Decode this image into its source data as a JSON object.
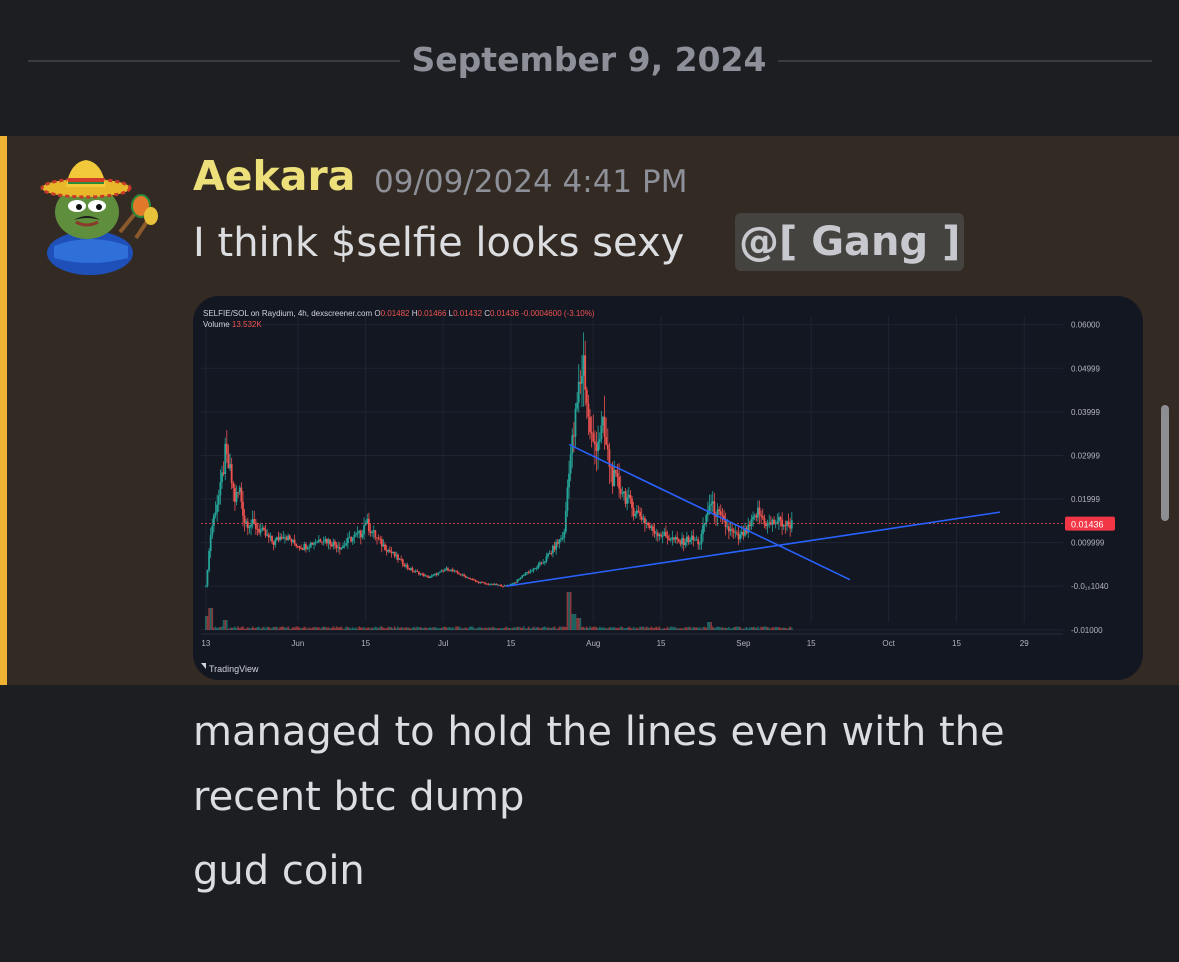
{
  "date_divider": "September 9, 2024",
  "message": {
    "author": "Aekara",
    "timestamp": "09/09/2024 4:41 PM",
    "text1": "I think $selfie looks sexy",
    "mention": "@[ Gang ]",
    "text2": "managed to hold the lines even with the recent btc dump",
    "text3": "gud coin"
  },
  "colors": {
    "background": "#1d1e22",
    "highlight": "#332b23",
    "highlight_bar": "#f0b232",
    "author": "#ede07a",
    "up_candle": "#26a69a",
    "down_candle": "#ef5350",
    "trendline": "#2962ff"
  },
  "chart_data": {
    "type": "candlestick",
    "header": {
      "symbol": "SELFIE/SOL on Raydium, 4h, dexscreener.com",
      "o_label": "O",
      "o_value": "0.01482",
      "h_label": "H",
      "h_value": "0.01466",
      "l_label": "L",
      "l_value": "0.01432",
      "c_label": "C",
      "c_value": "0.01436",
      "change": "-0.0004600 (-3.10%)",
      "volume_label": "Volume",
      "volume_value": "13.532K"
    },
    "y_ticks": [
      {
        "label": "0.06000",
        "v": 0.06
      },
      {
        "label": "0.04999",
        "v": 0.05
      },
      {
        "label": "0.03999",
        "v": 0.04
      },
      {
        "label": "0.02999",
        "v": 0.03
      },
      {
        "label": "0.01999",
        "v": 0.02
      },
      {
        "label": "0.009999",
        "v": 0.01
      },
      {
        "label": "-0.0₁₆1040",
        "v": 0.0
      },
      {
        "label": "-0.01000",
        "v": -0.01
      }
    ],
    "x_ticks": [
      {
        "label": "13",
        "d": 0
      },
      {
        "label": "Jun",
        "d": 19
      },
      {
        "label": "15",
        "d": 33
      },
      {
        "label": "Jul",
        "d": 49
      },
      {
        "label": "15",
        "d": 63
      },
      {
        "label": "Aug",
        "d": 80
      },
      {
        "label": "15",
        "d": 94
      },
      {
        "label": "Sep",
        "d": 111
      },
      {
        "label": "15",
        "d": 125
      },
      {
        "label": "Oct",
        "d": 141
      },
      {
        "label": "15",
        "d": 155
      },
      {
        "label": "29",
        "d": 169
      }
    ],
    "x_range": [
      -1,
      177
    ],
    "y_range": [
      -0.0105,
      0.062
    ],
    "current_price": {
      "label": "0.01436",
      "v": 0.01436
    },
    "price_path": [
      [
        0,
        0.0
      ],
      [
        1,
        0.012
      ],
      [
        2,
        0.018
      ],
      [
        3,
        0.022
      ],
      [
        4,
        0.03
      ],
      [
        5,
        0.026
      ],
      [
        6,
        0.02
      ],
      [
        7,
        0.022
      ],
      [
        8,
        0.015
      ],
      [
        10,
        0.014
      ],
      [
        12,
        0.012
      ],
      [
        14,
        0.01
      ],
      [
        16,
        0.012
      ],
      [
        18,
        0.01
      ],
      [
        20,
        0.009
      ],
      [
        22,
        0.01
      ],
      [
        24,
        0.011
      ],
      [
        26,
        0.01
      ],
      [
        28,
        0.009
      ],
      [
        30,
        0.011
      ],
      [
        32,
        0.012
      ],
      [
        33,
        0.015
      ],
      [
        34,
        0.013
      ],
      [
        36,
        0.01
      ],
      [
        38,
        0.008
      ],
      [
        40,
        0.006
      ],
      [
        42,
        0.004
      ],
      [
        44,
        0.003
      ],
      [
        46,
        0.002
      ],
      [
        48,
        0.003
      ],
      [
        50,
        0.004
      ],
      [
        52,
        0.003
      ],
      [
        54,
        0.002
      ],
      [
        56,
        0.001
      ],
      [
        58,
        0.0005
      ],
      [
        60,
        0.0003
      ],
      [
        62,
        0.0
      ],
      [
        64,
        0.001
      ],
      [
        66,
        0.003
      ],
      [
        68,
        0.004
      ],
      [
        70,
        0.006
      ],
      [
        72,
        0.009
      ],
      [
        74,
        0.012
      ],
      [
        75,
        0.028
      ],
      [
        76,
        0.035
      ],
      [
        77,
        0.045
      ],
      [
        78,
        0.052
      ],
      [
        79,
        0.038
      ],
      [
        80,
        0.032
      ],
      [
        82,
        0.036
      ],
      [
        83,
        0.03
      ],
      [
        84,
        0.025
      ],
      [
        86,
        0.022
      ],
      [
        88,
        0.018
      ],
      [
        90,
        0.016
      ],
      [
        92,
        0.013
      ],
      [
        94,
        0.012
      ],
      [
        96,
        0.011
      ],
      [
        98,
        0.01
      ],
      [
        100,
        0.011
      ],
      [
        102,
        0.01
      ],
      [
        104,
        0.019
      ],
      [
        106,
        0.016
      ],
      [
        108,
        0.013
      ],
      [
        110,
        0.011
      ],
      [
        112,
        0.013
      ],
      [
        114,
        0.017
      ],
      [
        116,
        0.014
      ],
      [
        118,
        0.015
      ],
      [
        120,
        0.014
      ],
      [
        121,
        0.01436
      ]
    ],
    "volume_spikes": [
      [
        0,
        0.35
      ],
      [
        1,
        0.55
      ],
      [
        4,
        0.25
      ],
      [
        75,
        0.95
      ],
      [
        76,
        0.4
      ],
      [
        77,
        0.3
      ],
      [
        104,
        0.2
      ]
    ],
    "trendlines": [
      {
        "from": [
          75,
          0.0325
        ],
        "to": [
          133,
          0.0015
        ]
      },
      {
        "from": [
          62,
          0.0
        ],
        "to": [
          164,
          0.017
        ]
      }
    ],
    "footer": "TradingView"
  }
}
